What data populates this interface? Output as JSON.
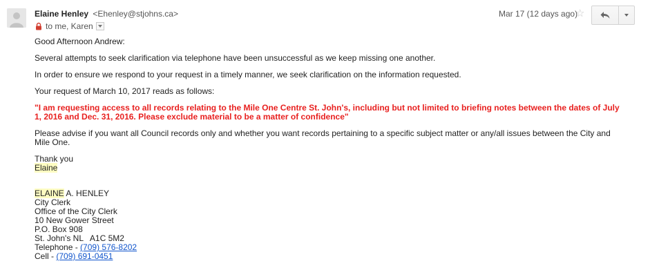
{
  "header": {
    "sender_name": "Elaine Henley",
    "sender_email": "<Ehenley@stjohns.ca>",
    "to_line": "to me, Karen",
    "date": "Mar 17 (12 days ago)"
  },
  "icons": {
    "avatar": "person-avatar-icon",
    "lock": "lock-icon",
    "star": "star-icon",
    "reply": "reply-icon",
    "more": "chevron-down-icon"
  },
  "colors": {
    "request_text": "#e8201f",
    "highlight": "#fdfcc1",
    "link": "#1155cc"
  },
  "body": {
    "greeting": "Good Afternoon Andrew:",
    "para1": "Several attempts to seek clarification via telephone have been unsuccessful as we keep missing one another.",
    "para2": "In order to ensure we respond to your request in a timely manner, we seek clarification on the information requested.",
    "para3": "Your request of March 10, 2017 reads as follows:",
    "request_quote": "\"I am requesting access to all records relating to the Mile One Centre St. John's, including but not limited to briefing notes between the dates of July 1, 2016 and Dec. 31, 2016. Please exclude material to be a matter of confidence\"",
    "para4": "Please advise if you want all Council records only and whether you want records pertaining to a specific subject matter or any/all issues between the City and Mile One.",
    "closing": "Thank you",
    "closing_name": "Elaine"
  },
  "signature": {
    "name_first": "ELAINE",
    "name_rest": " A. HENLEY",
    "title": "City Clerk",
    "office": "Office of the City Clerk",
    "street": "10 New Gower Street",
    "po_box": "P.O. Box 908",
    "city": "St. John's NL   A1C 5M2",
    "telephone_label": "Telephone - ",
    "telephone": "(709) 576-8202",
    "cell_label": "Cell - ",
    "cell": "(709) 691-0451"
  }
}
